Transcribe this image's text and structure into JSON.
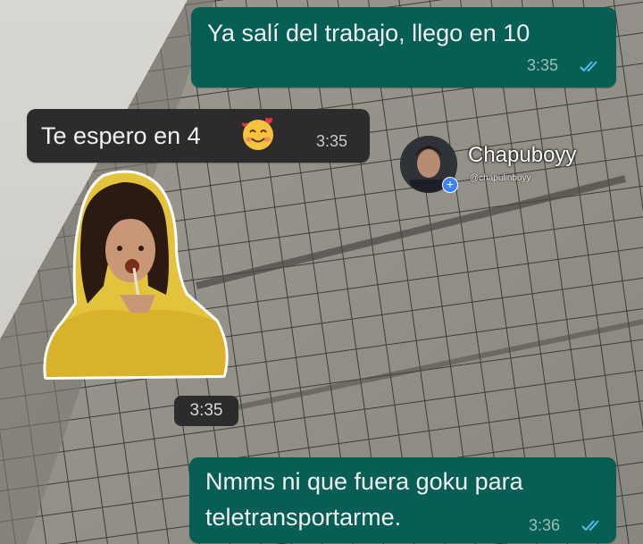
{
  "chat": {
    "messages": [
      {
        "direction": "outgoing",
        "text": "Ya salí del trabajo, llego en 10",
        "time": "3:35",
        "status": "read"
      },
      {
        "direction": "incoming",
        "text": "Te espero en 4",
        "emoji": "smiling-face-with-hearts",
        "time": "3:35"
      },
      {
        "direction": "incoming",
        "type": "sticker",
        "sticker": "woman-with-lollipop",
        "time": "3:35"
      },
      {
        "direction": "outgoing",
        "lines": [
          "Nmms ni que fuera goku para",
          "teletransportarme."
        ],
        "time": "3:36",
        "status": "read"
      }
    ]
  },
  "watermark": {
    "name": "Chapuboyy",
    "handle": "@chapulinboyy"
  },
  "colors": {
    "outgoing_bubble": "#075e54",
    "incoming_bubble": "#2c2c2c",
    "read_ticks": "#53bdeb"
  }
}
